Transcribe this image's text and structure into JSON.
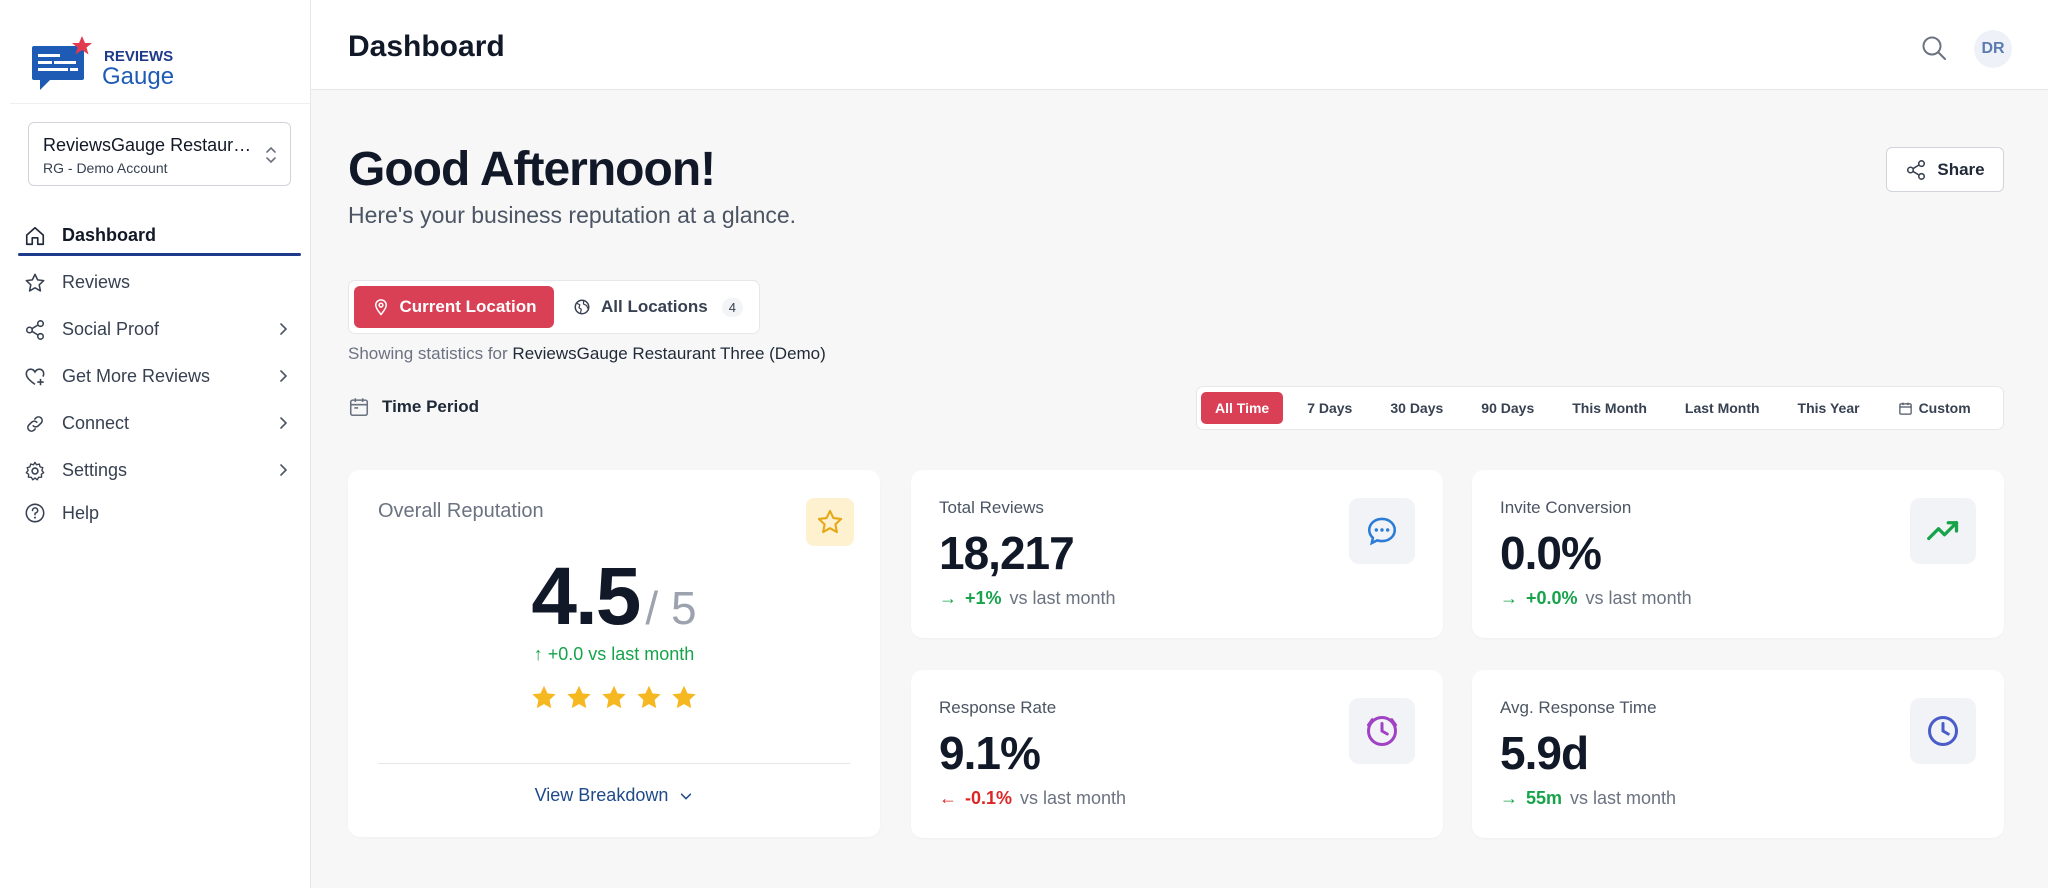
{
  "app": {
    "logo_text_top": "REVIEWS",
    "logo_text_bottom": "Gauge",
    "brand_color": "#d94055",
    "navy": "#1e3a8a"
  },
  "sidebar": {
    "location": {
      "name": "ReviewsGauge Restaurant Three (Demo)",
      "account": "RG - Demo Account"
    },
    "items": [
      {
        "label": "Dashboard",
        "icon": "home-icon",
        "active": true
      },
      {
        "label": "Reviews",
        "icon": "star-icon"
      },
      {
        "label": "Social Proof",
        "icon": "share-nodes-icon",
        "chevron": true
      },
      {
        "label": "Get More Reviews",
        "icon": "heart-plus-icon",
        "chevron": true
      },
      {
        "label": "Connect",
        "icon": "link-icon",
        "chevron": true
      },
      {
        "label": "Settings",
        "icon": "gear-icon",
        "chevron": true
      },
      {
        "label": "Help",
        "icon": "help-circle-icon"
      }
    ]
  },
  "header": {
    "title": "Dashboard",
    "avatar_initials": "DR"
  },
  "main": {
    "greeting": "Good Afternoon!",
    "subgreeting": "Here's your business reputation at a glance.",
    "share_label": "Share",
    "location_toggle": {
      "current": "Current Location",
      "all": "All Locations",
      "all_count": "4"
    },
    "stats_prefix": "Showing statistics for",
    "stats_location": "ReviewsGauge Restaurant Three (Demo)",
    "time_period_label": "Time Period",
    "periods": [
      "All Time",
      "7 Days",
      "30 Days",
      "90 Days",
      "This Month",
      "Last Month",
      "This Year",
      "Custom"
    ],
    "active_period": "All Time"
  },
  "reputation": {
    "title": "Overall Reputation",
    "score": "4.5",
    "out_of": "/ 5",
    "trend": "+0.0 vs last month",
    "stars": 5,
    "breakdown_label": "View Breakdown"
  },
  "stats": {
    "total_reviews": {
      "label": "Total Reviews",
      "value": "18,217",
      "delta": "+1%",
      "suffix": "vs last month",
      "icon": "chat-bubble-icon"
    },
    "invite_conversion": {
      "label": "Invite Conversion",
      "value": "0.0%",
      "delta": "+0.0%",
      "suffix": "vs last month",
      "icon": "trending-up-icon"
    },
    "response_rate": {
      "label": "Response Rate",
      "value": "9.1%",
      "delta": "-0.1%",
      "suffix": "vs last month",
      "icon": "clock-badge-icon"
    },
    "avg_response_time": {
      "label": "Avg. Response Time",
      "value": "5.9d",
      "delta": "55m",
      "suffix": "vs last month",
      "icon": "clock-icon"
    }
  }
}
